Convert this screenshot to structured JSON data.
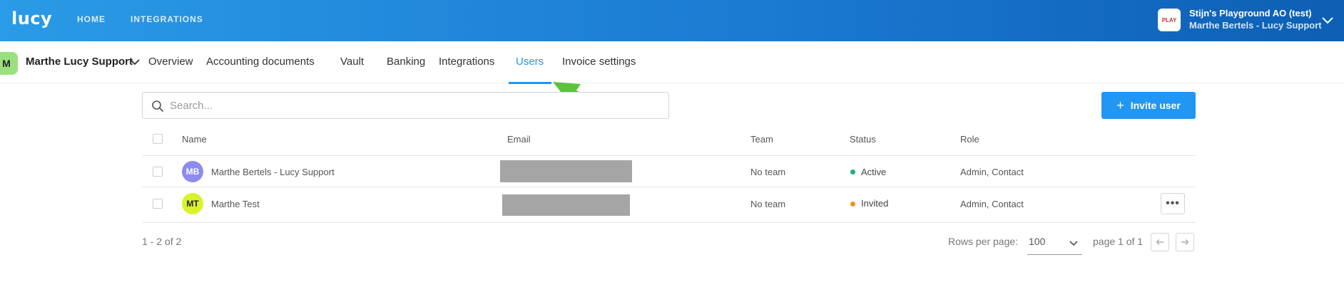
{
  "app": {
    "logo": "lucy"
  },
  "topnav": {
    "home": "HOME",
    "integrations": "INTEGRATIONS"
  },
  "org": {
    "name": "Stijn's Playground AO (test)",
    "user": "Marthe Bertels - Lucy Support",
    "logo_text": "PLAY"
  },
  "client": {
    "avatar": "M",
    "name": "Marthe Lucy Support"
  },
  "tabs": [
    {
      "label": "Overview"
    },
    {
      "label": "Accounting documents"
    },
    {
      "label": "Vault"
    },
    {
      "label": "Banking"
    },
    {
      "label": "Integrations"
    },
    {
      "label": "Users"
    },
    {
      "label": "Invoice settings"
    }
  ],
  "active_tab": "Users",
  "search": {
    "placeholder": "Search..."
  },
  "invite_button": {
    "label": "Invite user",
    "icon": "plus-icon"
  },
  "table": {
    "headers": {
      "name": "Name",
      "email": "Email",
      "team": "Team",
      "status": "Status",
      "role": "Role"
    },
    "rows": [
      {
        "initials": "MB",
        "avatar_color": "#8c8cf0",
        "name": "Marthe Bertels - Lucy Support",
        "team": "No team",
        "status": "Active",
        "status_color": "#1fae7a",
        "role": "Admin, Contact"
      },
      {
        "initials": "MT",
        "avatar_color": "#d9f22a",
        "name": "Marthe Test",
        "team": "No team",
        "status": "Invited",
        "status_color": "#f0921e",
        "role": "Admin, Contact"
      }
    ]
  },
  "footer": {
    "range": "1 - 2 of 2",
    "rows_per_page_label": "Rows per page:",
    "rows_per_page_value": "100",
    "page": "page 1 of 1"
  },
  "colors": {
    "accent": "#2196f3",
    "arrow": "#5cc23a",
    "topbar": "#1a78d0"
  }
}
